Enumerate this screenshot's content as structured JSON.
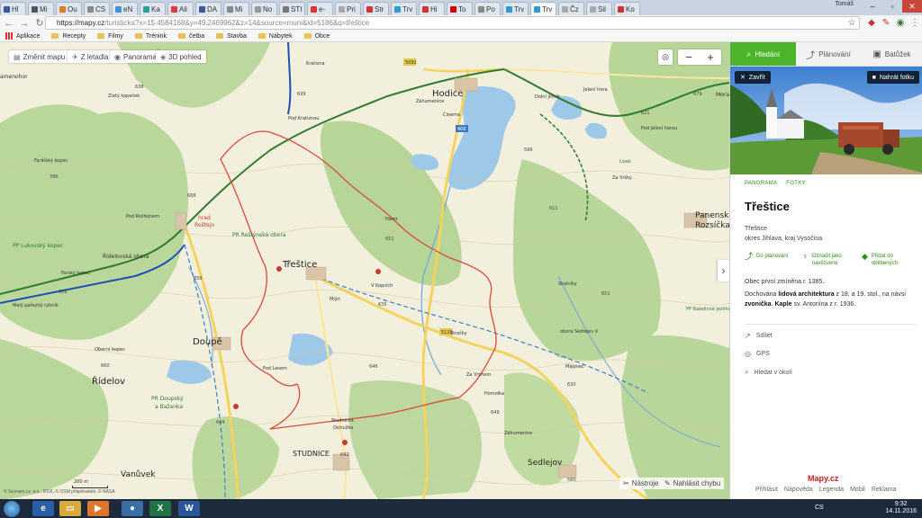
{
  "browser": {
    "tabs": [
      "Hl",
      "Mi",
      "Ou",
      "CS",
      "eN",
      "Ka",
      "Ali",
      "DA",
      "Mi",
      "No",
      "STI",
      "e-",
      "Pri",
      "Str",
      "Trv",
      "Hi",
      "To",
      "Po",
      "Trv",
      "Trv",
      "Čz",
      "Sil",
      "Ko"
    ],
    "user_badge": "Tomáš",
    "url_host": "https://mapy.cz",
    "url_rest": "/turisticka?x=15.4584168&y=49.2469962&z=14&source=muni&id=5186&q=třeštice",
    "bookmarks": [
      {
        "label": "Aplikace",
        "type": "apps"
      },
      {
        "label": "Recepty",
        "type": "folder"
      },
      {
        "label": "Filmy",
        "type": "folder"
      },
      {
        "label": "Trénink",
        "type": "folder"
      },
      {
        "label": "četba",
        "type": "folder"
      },
      {
        "label": "Stavba",
        "type": "folder"
      },
      {
        "label": "Nábytek",
        "type": "folder"
      },
      {
        "label": "Obce",
        "type": "folder"
      }
    ]
  },
  "map": {
    "controls": {
      "change_map": "Změnit mapu",
      "aerial": "Z letadla",
      "panorama": "Panorama",
      "view_3d": "3D pohled",
      "zoom_in": "+",
      "zoom_out": "−"
    },
    "bottom_tools": [
      "Nástroje",
      "Nahlásit chybu"
    ],
    "attribution": "© Seznam.cz, a.s., 2016, © OSM přispěvatelé, © NASA",
    "scale_label": "200 m",
    "towns": {
      "hodice": "Hodice",
      "trestice": "Třeštice",
      "doupe": "Doupě",
      "ridelov": "Řídelov",
      "vanuvek": "Vanůvek",
      "studnice": "STUDNICE",
      "sedlejov": "Sedlejov",
      "panenska": "Panenská",
      "rozsicka": "Rozsíčka",
      "kamenohor": "amenohor",
      "morav": "Morav"
    },
    "places": {
      "pod_kratiznou": "Pod Kratiznou",
      "pod_rostejnem": "Pod Roštejnem",
      "hrad_rostejn_1": "hrad",
      "hrad_rostejn_2": "Roštejn",
      "pod_jeleni_horou": "Pod Jelení horou",
      "maly_parezity": "Malý pařezitý rybník",
      "obecni_kopec": "Obecní kopec",
      "zlaty_kopecek": "Zlatý kopeček",
      "farafsky": "Farářský kopec",
      "pr_rostynska": "PR Roštýnská obora",
      "pr_lukovsky": "PP Lukovský kopec",
      "ridelovska": "Řídelovská obora",
      "farsky": "Farský kopec",
      "pr_doupsky": "PR Doupský",
      "bazanka": "a Bažanka",
      "pod_lesem": "Pod Lesem",
      "studnicka": "Studnická",
      "ostruzka": "Ostružka",
      "zahumeni": "Záhumenice",
      "hamr": "Hamr",
      "mlyn": "Mlýn",
      "v_kopcich": "V Kopcích",
      "za_vrchem": "Za Vrchem",
      "hornolka": "Homolka",
      "majovec": "Májovec",
      "strocky": "Stročky",
      "zahumeni2": "Záhumenice",
      "pp_rasel": "PP Rašelinné jezírko Rosička",
      "obora_sedlejov": "obora Sedlejov II",
      "kratizna": "Kratizna",
      "cinema": "Cinema",
      "dolni_jilmik": "Dolní jílmík",
      "jeleni_hora": "Jelení hora",
      "skalniky": "Skalníky",
      "za_vrsky": "Za Vršky",
      "lisek": "Lisek"
    },
    "elevations": [
      "638",
      "639",
      "688",
      "786",
      "656",
      "669",
      "660",
      "644",
      "642",
      "651",
      "635",
      "646",
      "649",
      "630",
      "651",
      "611",
      "596",
      "621",
      "580",
      "679"
    ],
    "route_labels": [
      "406",
      "5092",
      "5123"
    ]
  },
  "sidebar": {
    "tabs": [
      {
        "label": "Hledání",
        "icon": "search-icon",
        "active": true
      },
      {
        "label": "Plánování",
        "icon": "route-icon",
        "active": false
      },
      {
        "label": "Batůžek",
        "icon": "backpack-icon",
        "active": false
      }
    ],
    "close_label": "Zavřít",
    "add_photo_label": "Nahrát fotku",
    "photo_tabs": [
      "PANORAMA",
      "FOTKY"
    ],
    "title": "Třeštice",
    "subtitle": "Třeštice",
    "region": "okres Jihlava, kraj Vysočina",
    "actions": [
      {
        "label": "Do plánování",
        "icon": "plan-icon"
      },
      {
        "label": "Označit jako navštívené",
        "icon": "visited-icon"
      },
      {
        "label": "Přidat do oblíbených",
        "icon": "favorite-icon"
      }
    ],
    "desc_first": "Obec první zmíněna r. 1385.",
    "desc_a": "Dochována ",
    "desc_b": "lidová architektura",
    "desc_c": " z 18. a 19. stol., na návsi ",
    "desc_d": "zvonička",
    "desc_e": ". ",
    "desc_f": "Kaple",
    "desc_g": " sv. Antonína z r. 1936.",
    "links": [
      {
        "label": "Sdílet",
        "icon": "share-icon"
      },
      {
        "label": "GPS",
        "icon": "gps-icon"
      },
      {
        "label": "Hledat v okolí",
        "icon": "search-nearby-icon"
      }
    ],
    "logo": "Mapy.cz",
    "footer": [
      "Přihlásit",
      "Nápověda",
      "Legenda",
      "Mobil",
      "Reklama"
    ]
  },
  "taskbar": {
    "language": "CS",
    "time": "9:32",
    "date": "14.11.2016"
  }
}
